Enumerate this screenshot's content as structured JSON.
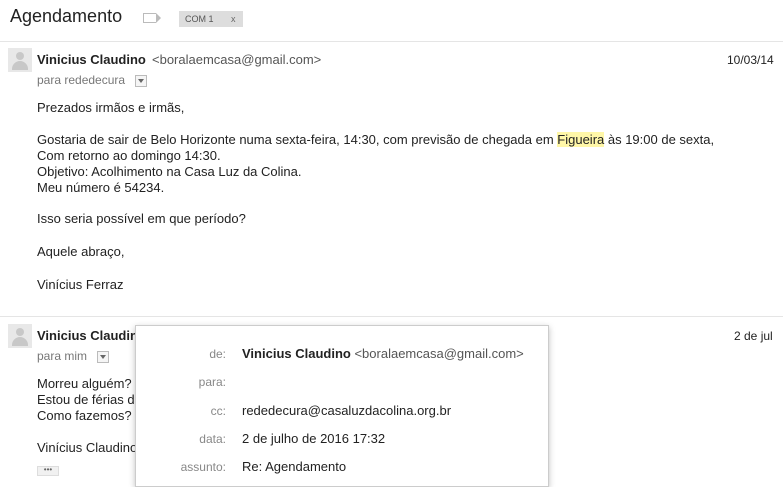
{
  "thread": {
    "subject": "Agendamento",
    "tag": "COM 1",
    "tag_close": "x"
  },
  "messages": [
    {
      "sender": "Vinicius Claudino",
      "email": "<boralaemcasa@gmail.com>",
      "date": "10/03/14",
      "to": "para rededecura",
      "body": {
        "l1": "Prezados irmãos e irmãs,",
        "l2_a": "Gostaria de sair de Belo Horizonte numa sexta-feira, 14:30, com previsão de chegada em ",
        "l2_hl": "Figueira",
        "l2_b": " às 19:00 de sexta,",
        "l3": "Com retorno ao domingo 14:30.",
        "l4": "Objetivo: Acolhimento na Casa Luz da Colina.",
        "l5": "Meu número é 54234.",
        "l6": "Isso seria possível em que período?",
        "l7": "Aquele abraço,",
        "l8": "Vinícius Ferraz"
      }
    },
    {
      "sender": "Vinicius Claudino",
      "date": "2 de jul",
      "to": "para mim",
      "body": {
        "l1": "Morreu alguém?",
        "l2": "Estou de férias d",
        "l3": "Como fazemos?",
        "l4": "Vinícius Claudino"
      },
      "ellipsis": "•••"
    }
  ],
  "details_popup": {
    "from_label": "de:",
    "from_name": "Vinicius Claudino",
    "from_email": "<boralaemcasa@gmail.com>",
    "to_label": "para:",
    "to_value": "",
    "cc_label": "cc:",
    "cc_value": "rededecura@casaluzdacolina.org.br",
    "date_label": "data:",
    "date_value": "2 de julho de 2016 17:32",
    "subject_label": "assunto:",
    "subject_value": "Re: Agendamento"
  }
}
